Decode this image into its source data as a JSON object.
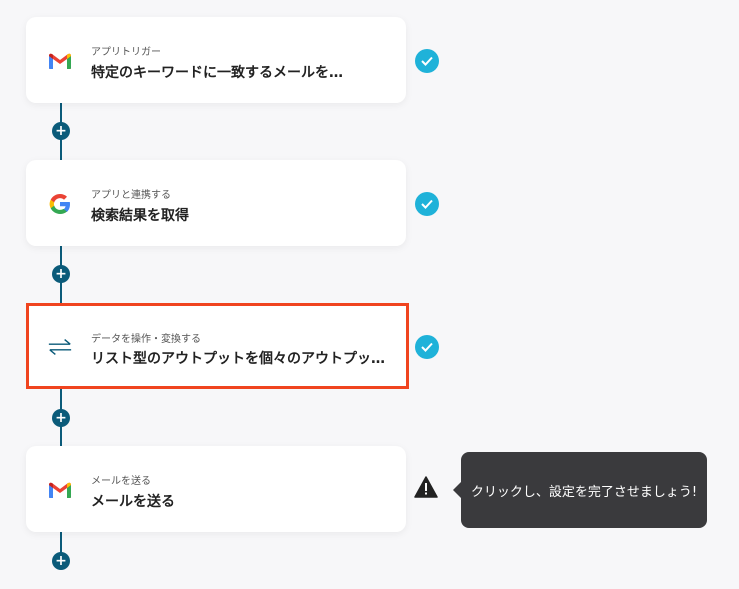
{
  "flow": {
    "steps": [
      {
        "subtitle": "アプリトリガー",
        "title": "特定のキーワードに一致するメールを…",
        "icon": "gmail-icon",
        "status": "done"
      },
      {
        "subtitle": "アプリと連携する",
        "title": "検索結果を取得",
        "icon": "google-icon",
        "status": "done"
      },
      {
        "subtitle": "データを操作・変換する",
        "title": "リスト型のアウトプットを個々のアウトプッ…",
        "icon": "transform-arrows-icon",
        "status": "done",
        "selected": true
      },
      {
        "subtitle": "メールを送る",
        "title": "メールを送る",
        "icon": "gmail-icon",
        "status": "warning"
      }
    ],
    "add_button_label": "+"
  },
  "tooltip": {
    "text": "クリックし、設定を完了させましょう!"
  },
  "colors": {
    "connector": "#0b5b7a",
    "check": "#1fb2d9",
    "selected_border": "#f0441f",
    "tooltip_bg": "#3a3a3d"
  }
}
